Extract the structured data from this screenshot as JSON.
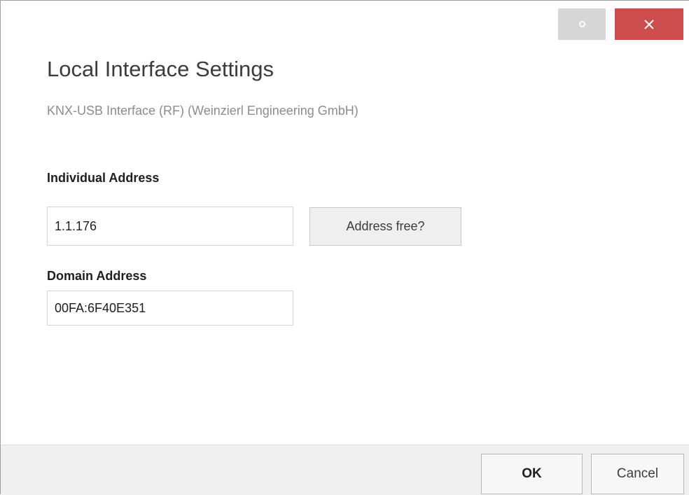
{
  "window": {
    "restore_icon": "circle-icon",
    "close_icon": "close-x-icon",
    "close_color": "#cd4c4c"
  },
  "dialog": {
    "title": "Local Interface Settings",
    "subtitle": "KNX-USB Interface (RF) (Weinzierl Engineering GmbH)"
  },
  "individual_address": {
    "label": "Individual Address",
    "value": "1.1.176",
    "check_button_label": "Address free?"
  },
  "domain_address": {
    "label": "Domain Address",
    "value": "00FA:6F40E351"
  },
  "footer": {
    "ok_label": "OK",
    "cancel_label": "Cancel"
  }
}
